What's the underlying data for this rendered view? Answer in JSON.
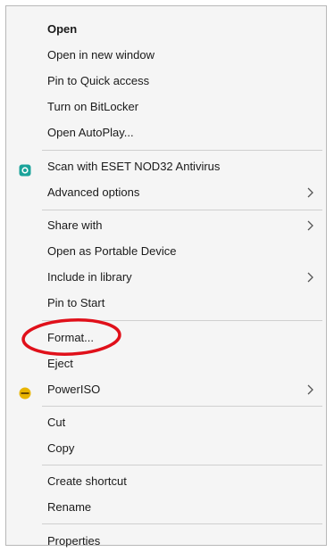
{
  "context_menu": {
    "items": [
      {
        "label": "Open"
      },
      {
        "label": "Open in new window"
      },
      {
        "label": "Pin to Quick access"
      },
      {
        "label": "Turn on BitLocker"
      },
      {
        "label": "Open AutoPlay..."
      },
      {
        "label": "Scan with ESET NOD32 Antivirus",
        "icon": "eset-icon"
      },
      {
        "label": "Advanced options",
        "submenu": true
      },
      {
        "label": "Share with",
        "submenu": true
      },
      {
        "label": "Open as Portable Device"
      },
      {
        "label": "Include in library",
        "submenu": true
      },
      {
        "label": "Pin to Start"
      },
      {
        "label": "Format..."
      },
      {
        "label": "Eject"
      },
      {
        "label": "PowerISO",
        "icon": "poweriso-icon",
        "submenu": true
      },
      {
        "label": "Cut"
      },
      {
        "label": "Copy"
      },
      {
        "label": "Create shortcut"
      },
      {
        "label": "Rename"
      },
      {
        "label": "Properties"
      }
    ]
  },
  "colors": {
    "highlight_circle": "#e0101a",
    "eset_icon": "#1aa39a",
    "poweriso_icon": "#e8b400"
  }
}
